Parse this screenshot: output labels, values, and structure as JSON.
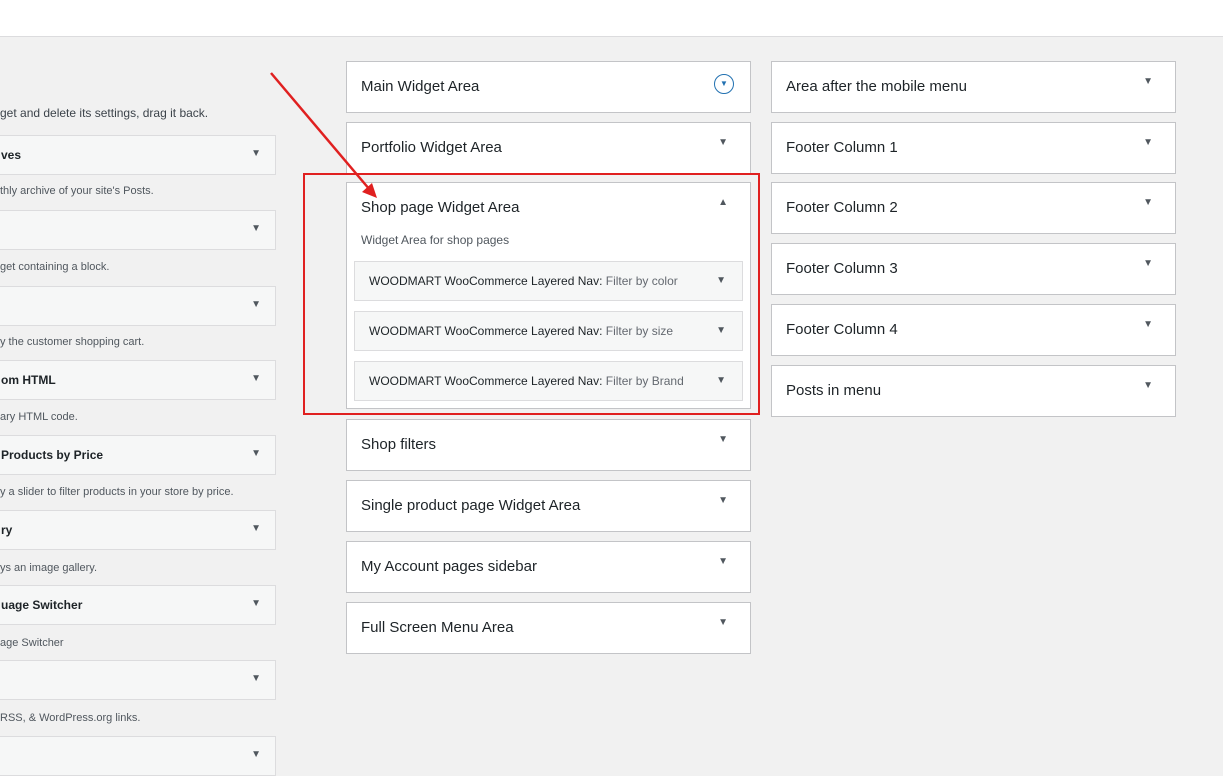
{
  "available": {
    "hint": "get and delete its settings, drag it back.",
    "widgets": [
      {
        "title": "ves",
        "desc": "thly archive of your site's Posts."
      },
      {
        "title": "",
        "desc": "get containing a block."
      },
      {
        "title": "",
        "desc": "y the customer shopping cart."
      },
      {
        "title": "om HTML",
        "desc": "ary HTML code."
      },
      {
        "title": "Products by Price",
        "desc": "y a slider to filter products in your store by price."
      },
      {
        "title": "ry",
        "desc": "ys an image gallery."
      },
      {
        "title": "uage Switcher",
        "desc": "age Switcher"
      },
      {
        "title": "",
        "desc": "RSS, & WordPress.org links."
      },
      {
        "title": "",
        "desc": ""
      }
    ]
  },
  "areas_left": [
    {
      "title": "Main Widget Area"
    },
    {
      "title": "Portfolio Widget Area"
    },
    {
      "title": "Shop page Widget Area",
      "desc": "Widget Area for shop pages"
    },
    {
      "title": "Shop filters"
    },
    {
      "title": "Single product page Widget Area"
    },
    {
      "title": "My Account pages sidebar"
    },
    {
      "title": "Full Screen Menu Area"
    }
  ],
  "shop_widgets": [
    {
      "name": "WOODMART WooCommerce Layered Nav:",
      "sub": "Filter by color"
    },
    {
      "name": "WOODMART WooCommerce Layered Nav:",
      "sub": "Filter by size"
    },
    {
      "name": "WOODMART WooCommerce Layered Nav:",
      "sub": "Filter by Brand"
    }
  ],
  "areas_right": [
    {
      "title": "Area after the mobile menu"
    },
    {
      "title": "Footer Column 1"
    },
    {
      "title": "Footer Column 2"
    },
    {
      "title": "Footer Column 3"
    },
    {
      "title": "Footer Column 4"
    },
    {
      "title": "Posts in menu"
    }
  ],
  "icons": {
    "expand": "triangle-down-icon",
    "collapse": "triangle-up-icon",
    "toggle": "circle-chevron-down-icon"
  },
  "colors": {
    "annotation": "#e02020",
    "accent": "#2271b1"
  }
}
